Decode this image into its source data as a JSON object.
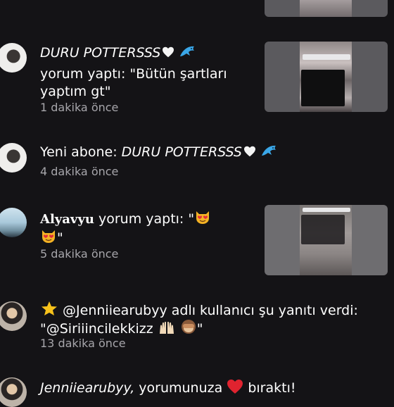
{
  "notifications": [
    {
      "user": "DURU POTTERSSS",
      "prefix": "",
      "action_line1": "yorum yaptı: \"Bütün şartları",
      "action_line2": "yaptım gt\"",
      "time": "1 dakika önce"
    },
    {
      "prefix": "Yeni abone: ",
      "user": "DURU POTTERSSS",
      "time": "4 dakika önce"
    },
    {
      "user": "Alyavyu",
      "action": " yorum yaptı: \"",
      "line2_end": "\"",
      "time": "5 dakika önce"
    },
    {
      "text_line1": "@Jenniiearubyy adlı kullanıcı şu yanıtı verdi:",
      "text_line2": "\"@Siriiincilekkizz",
      "text_line2_end": "\"",
      "time": "13 dakika önce"
    },
    {
      "user": "Jenniiearubyy,",
      "action": " yorumunuza",
      "action_end": "bıraktı!"
    }
  ],
  "icons": {
    "heart_white": "white-heart-icon",
    "dolphin": "dolphin-icon",
    "heart_eyes_cat": "heart-eyes-cat-icon",
    "star": "glowing-star-icon",
    "raised_hands": "raised-hands-icon",
    "see_no_evil": "see-no-evil-monkey-icon",
    "red_heart": "red-heart-icon"
  },
  "colors": {
    "background": "#141316",
    "text": "#ffffff",
    "muted": "#a7a6ab",
    "red_heart": "#e0232f"
  }
}
